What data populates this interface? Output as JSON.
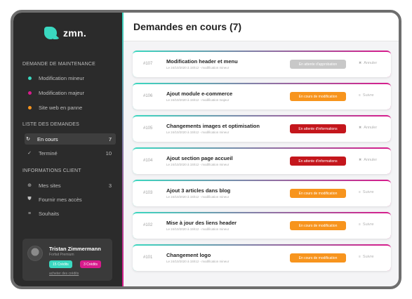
{
  "app": {
    "logo_text": "zmn."
  },
  "sidebar": {
    "maintenance_title": "DEMANDE DE MAINTENANCE",
    "maintenance_items": [
      {
        "label": "Modification mineur",
        "color": "#3ad8c0"
      },
      {
        "label": "Modification majeur",
        "color": "#d81b8c"
      },
      {
        "label": "Site web en panne",
        "color": "#f7941d"
      }
    ],
    "requests_title": "LISTE DES DEMANDES",
    "requests_items": [
      {
        "label": "En cours",
        "count": "7",
        "icon": "spinner-icon"
      },
      {
        "label": "Terminé",
        "count": "10",
        "icon": "check-circle-icon"
      }
    ],
    "client_title": "INFORMATIONS CLIENT",
    "client_items": [
      {
        "label": "Mes sites",
        "count": "3",
        "icon": "globe-icon"
      },
      {
        "label": "Fournir mes accès",
        "count": "",
        "icon": "shield-icon"
      },
      {
        "label": "Souhaits",
        "count": "",
        "icon": "list-icon"
      }
    ],
    "user": {
      "name": "Tristan Zimmermann",
      "plan": "Forfait Premium",
      "credit_a": "15 Crédits",
      "credit_b": "3 Crédits",
      "buy_link": "acheter des crédits"
    }
  },
  "main": {
    "title": "Demandes en cours (7)",
    "requests": [
      {
        "id": "#107",
        "title": "Modification header et menu",
        "meta": "Le 24/10/2020 à 15h12 - modification mineur",
        "status": "En attente d'approbation",
        "status_color": "#c8c8c8",
        "action": "Annuler",
        "action_icon": "trash-icon"
      },
      {
        "id": "#106",
        "title": "Ajout module e-commerce",
        "meta": "Le 24/10/2020 à 15h12 - modification majeur",
        "status": "En cours de modification",
        "status_color": "#f7941d",
        "action": "Suivre",
        "action_icon": "list-icon"
      },
      {
        "id": "#105",
        "title": "Changements images et optimisation",
        "meta": "Le 24/10/2020 à 15h12 - modification mineur",
        "status": "En attente d'informations",
        "status_color": "#c4161c",
        "action": "Annuler",
        "action_icon": "trash-icon"
      },
      {
        "id": "#104",
        "title": "Ajout section page accueil",
        "meta": "Le 24/10/2020 à 15h12 - modification mineur",
        "status": "En attente d'informations",
        "status_color": "#c4161c",
        "action": "Annuler",
        "action_icon": "trash-icon"
      },
      {
        "id": "#103",
        "title": "Ajout 3 articles dans blog",
        "meta": "Le 24/10/2020 à 15h12 - modification mineur",
        "status": "En cours de modification",
        "status_color": "#f7941d",
        "action": "Suivre",
        "action_icon": "list-icon"
      },
      {
        "id": "#102",
        "title": "Mise à jour des liens header",
        "meta": "Le 24/10/2020 à 15h12 - modification mineur",
        "status": "En cours de modification",
        "status_color": "#f7941d",
        "action": "Suivre",
        "action_icon": "list-icon"
      },
      {
        "id": "#101",
        "title": "Changement logo",
        "meta": "Le 24/10/2020 à 15h12 - modification mineur",
        "status": "En cours de modification",
        "status_color": "#f7941d",
        "action": "Suivre",
        "action_icon": "list-icon"
      }
    ]
  },
  "colors": {
    "accent_teal": "#3ad8c0",
    "accent_pink": "#d81b8c",
    "sidebar_bg": "#2b2b2b"
  }
}
